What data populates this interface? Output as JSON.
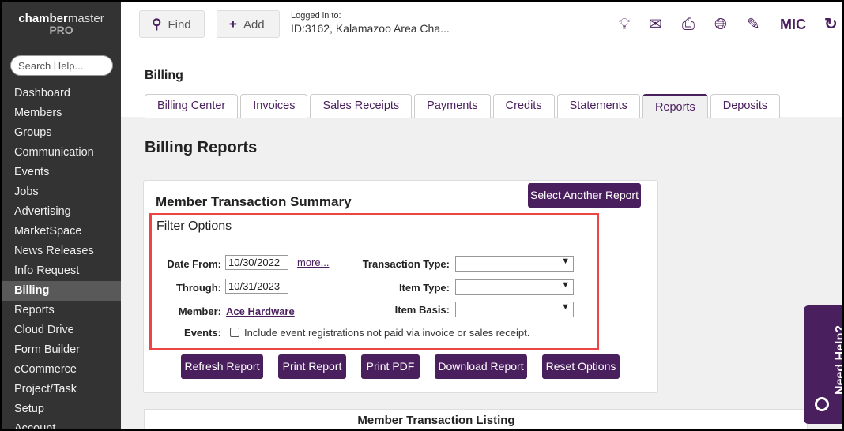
{
  "sidebar": {
    "logo_bold": "chamber",
    "logo_rest": "master",
    "logo_pro": "PRO",
    "search_placeholder": "Search Help...",
    "items": [
      "Dashboard",
      "Members",
      "Groups",
      "Communication",
      "Events",
      "Jobs",
      "Advertising",
      "MarketSpace",
      "News Releases",
      "Info Request",
      "Billing",
      "Reports",
      "Cloud Drive",
      "Form Builder",
      "eCommerce",
      "Project/Task",
      "Setup",
      "Account"
    ],
    "active": "Billing"
  },
  "topbar": {
    "find": "Find",
    "add": "Add",
    "logged_label": "Logged in to:",
    "logged_value": "ID:3162, Kalamazoo Area Cha...",
    "user": "MIC"
  },
  "section": {
    "title": "Billing",
    "tabs": [
      "Billing Center",
      "Invoices",
      "Sales Receipts",
      "Payments",
      "Credits",
      "Statements",
      "Reports",
      "Deposits"
    ],
    "active_tab": "Reports"
  },
  "page": {
    "title": "Billing Reports",
    "report_title": "Member Transaction Summary",
    "select_another": "Select Another Report",
    "filter": {
      "title": "Filter Options",
      "date_from_label": "Date From:",
      "date_from": "10/30/2022",
      "more": "more...",
      "through_label": "Through:",
      "through": "10/31/2023",
      "member_label": "Member:",
      "member": "Ace Hardware",
      "events_label": "Events:",
      "events_text": "Include event registrations not paid via invoice or sales receipt.",
      "transaction_type_label": "Transaction Type:",
      "item_type_label": "Item Type:",
      "item_basis_label": "Item Basis:"
    },
    "buttons": [
      "Refresh Report",
      "Print Report",
      "Print PDF",
      "Download Report",
      "Reset Options"
    ],
    "listing_title": "Member Transaction Listing"
  },
  "help": "Need Help?"
}
